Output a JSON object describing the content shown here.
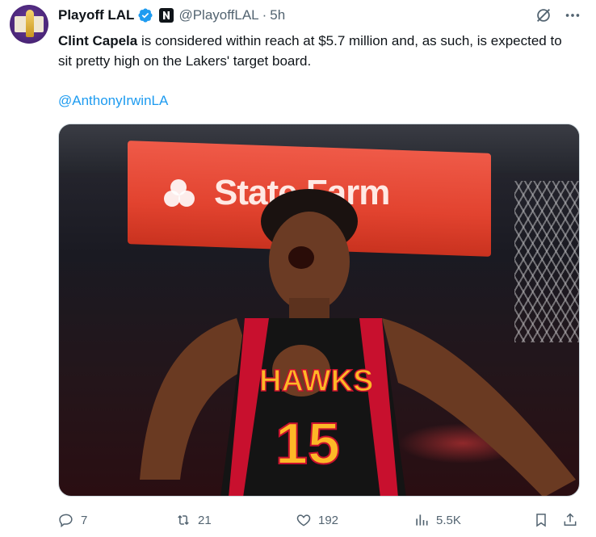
{
  "author": {
    "display_name": "Playoff LAL",
    "handle": "@PlayoffLAL",
    "separator": "·",
    "time": "5h",
    "verified": true
  },
  "tweet": {
    "bold_name": "Clint Capela",
    "text_rest": " is considered within reach at $5.7 million and, as such, is expected to sit pretty high on the Lakers' target board.",
    "mention": "@AnthonyIrwinLA"
  },
  "media": {
    "sign_text": "State Farm",
    "jersey_team": "HAWKS",
    "jersey_number": "15"
  },
  "actions": {
    "replies": "7",
    "retweets": "21",
    "likes": "192",
    "views": "5.5K"
  },
  "colors": {
    "accent": "#1d9bf0",
    "muted": "#536471",
    "text": "#0f1419"
  }
}
